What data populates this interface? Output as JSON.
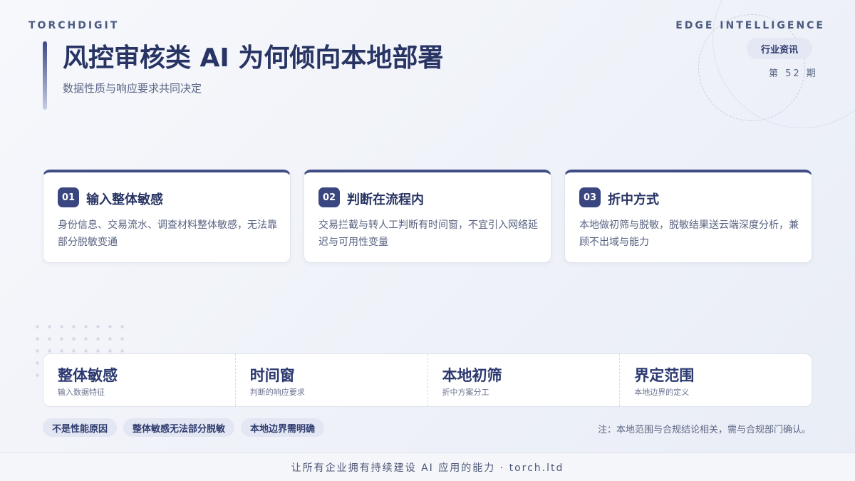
{
  "brand": {
    "left": "TORCHDIGIT",
    "right": "EDGE INTELLIGENCE"
  },
  "category_badge": "行业资讯",
  "issue": "第 52 期",
  "title": "风控审核类 AI 为何倾向本地部署",
  "subtitle": "数据性质与响应要求共同决定",
  "cards": [
    {
      "num": "01",
      "title": "输入整体敏感",
      "text": "身份信息、交易流水、调查材料整体敏感，无法靠部分脱敏变通"
    },
    {
      "num": "02",
      "title": "判断在流程内",
      "text": "交易拦截与转人工判断有时间窗，不宜引入网络延迟与可用性变量"
    },
    {
      "num": "03",
      "title": "折中方式",
      "text": "本地做初筛与脱敏，脱敏结果送云端深度分析，兼顾不出域与能力"
    }
  ],
  "stats": [
    {
      "value": "整体敏感",
      "label": "输入数据特征"
    },
    {
      "value": "时间窗",
      "label": "判断的响应要求"
    },
    {
      "value": "本地初筛",
      "label": "折中方案分工"
    },
    {
      "value": "界定范围",
      "label": "本地边界的定义"
    }
  ],
  "tags": [
    "不是性能原因",
    "整体敏感无法部分脱敏",
    "本地边界需明确"
  ],
  "footnote": "注：本地范围与合规结论相关，需与合规部门确认。",
  "footer": "让所有企业拥有持续建设 AI 应用的能力 · torch.ltd"
}
